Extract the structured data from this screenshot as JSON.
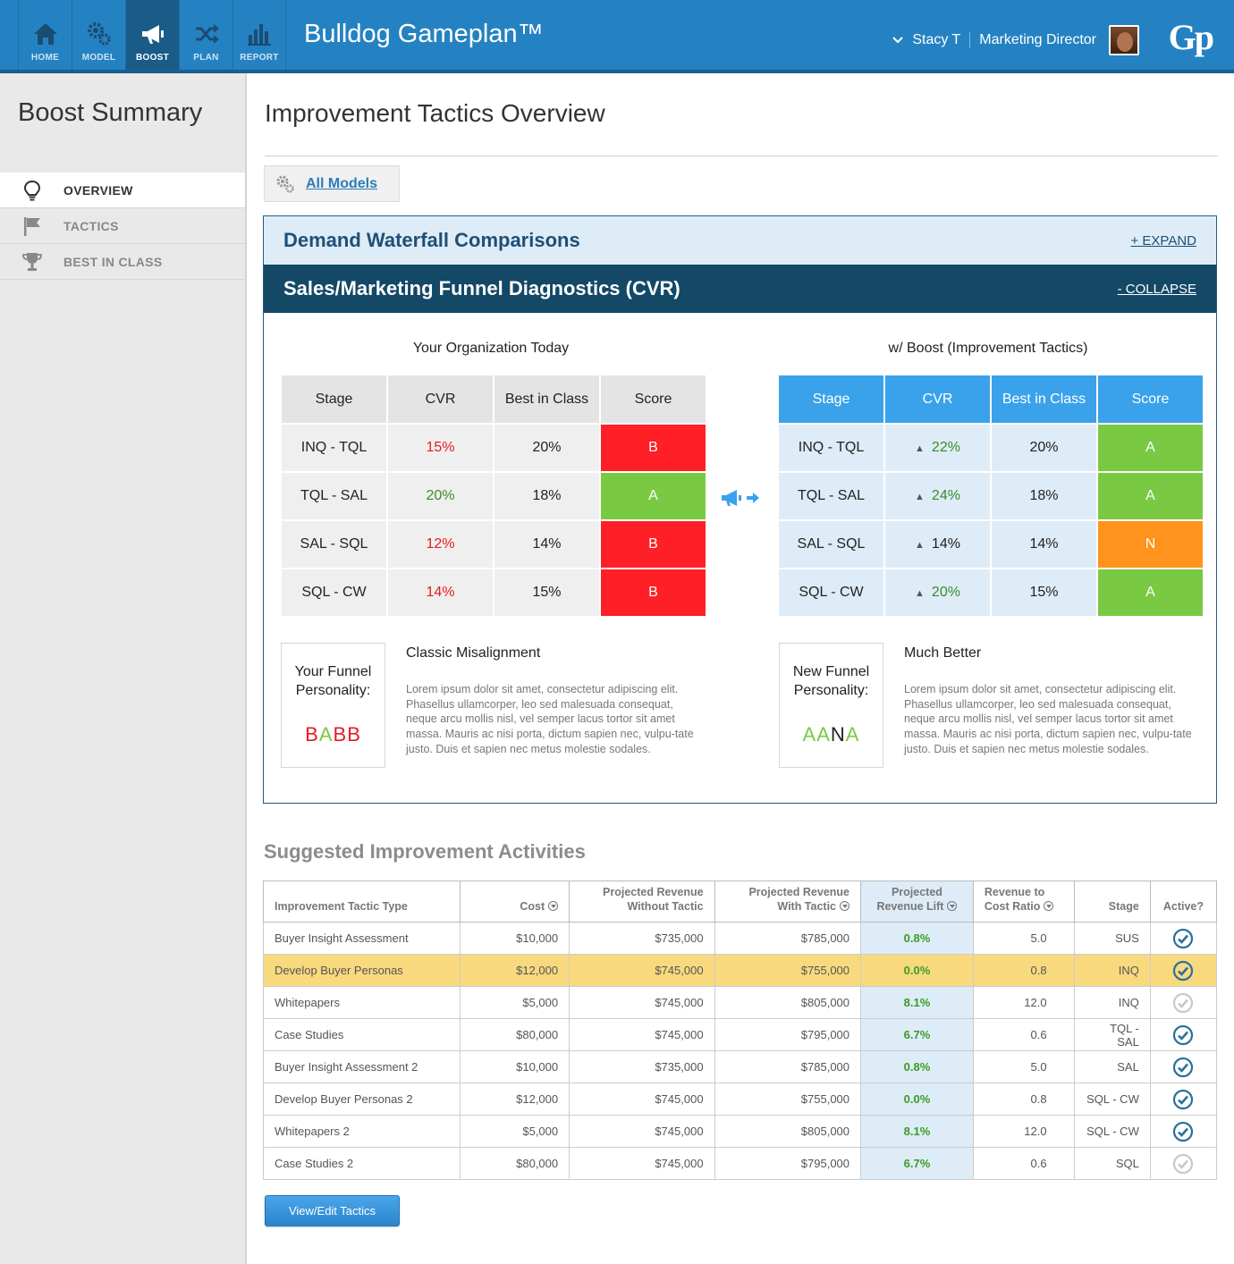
{
  "header": {
    "app_title": "Bulldog Gameplan™",
    "logo": "Gp",
    "user_name": "Stacy T",
    "user_role": "Marketing Director",
    "nav": [
      {
        "label": "HOME",
        "icon": "home-icon"
      },
      {
        "label": "MODEL",
        "icon": "gears-icon"
      },
      {
        "label": "BOOST",
        "icon": "megaphone-icon",
        "active": true
      },
      {
        "label": "PLAN",
        "icon": "shuffle-icon"
      },
      {
        "label": "REPORT",
        "icon": "bar-chart-icon"
      }
    ]
  },
  "sidebar": {
    "title": "Boost Summary",
    "items": [
      {
        "label": "OVERVIEW",
        "icon": "lightbulb-icon",
        "active": true
      },
      {
        "label": "TACTICS",
        "icon": "flag-icon"
      },
      {
        "label": "BEST IN CLASS",
        "icon": "trophy-icon"
      }
    ]
  },
  "main": {
    "title": "Improvement Tactics Overview",
    "all_models": "All Models",
    "panel": {
      "waterfall_title": "Demand Waterfall Comparisons",
      "expand": "+ EXPAND",
      "funnel_title": "Sales/Marketing Funnel Diagnostics (CVR)",
      "collapse": "- COLLAPSE",
      "left_title": "Your Organization Today",
      "right_title": "w/ Boost (Improvement Tactics)",
      "columns": [
        "Stage",
        "CVR",
        "Best in Class",
        "Score"
      ],
      "today_rows": [
        {
          "stage": "INQ - TQL",
          "cvr": "15%",
          "best": "20%",
          "score": "B"
        },
        {
          "stage": "TQL - SAL",
          "cvr": "20%",
          "best": "18%",
          "score": "A"
        },
        {
          "stage": "SAL - SQL",
          "cvr": "12%",
          "best": "14%",
          "score": "B"
        },
        {
          "stage": "SQL - CW",
          "cvr": "14%",
          "best": "15%",
          "score": "B"
        }
      ],
      "boost_rows": [
        {
          "stage": "INQ - TQL",
          "cvr": "22%",
          "best": "20%",
          "score": "A"
        },
        {
          "stage": "TQL - SAL",
          "cvr": "24%",
          "best": "18%",
          "score": "A"
        },
        {
          "stage": "SAL - SQL",
          "cvr": "14%",
          "best": "14%",
          "score": "N"
        },
        {
          "stage": "SQL - CW",
          "cvr": "20%",
          "best": "15%",
          "score": "A"
        }
      ],
      "colors": {
        "red": "#ff1f26",
        "green": "#7ac943",
        "orange": "#ff931e"
      },
      "left_persona": {
        "label_line1": "Your Funnel",
        "label_line2": "Personality:",
        "code": [
          "B",
          "A",
          "B",
          "B"
        ],
        "heading": "Classic Misalignment",
        "text": "Lorem ipsum dolor sit amet, consectetur adipiscing elit. Phasellus ullamcorper, leo sed malesuada consequat, neque arcu mollis nisl, vel semper lacus tortor sit amet massa. Mauris ac nisi porta, dictum sapien nec, vulpu-tate justo. Duis et sapien nec metus molestie sodales."
      },
      "right_persona": {
        "label_line1": "New Funnel",
        "label_line2": "Personality:",
        "code": [
          "A",
          "A",
          "N",
          "A"
        ],
        "heading": "Much Better",
        "text": "Lorem ipsum dolor sit amet, consectetur adipiscing elit. Phasellus ullamcorper, leo sed malesuada consequat, neque arcu mollis nisl, vel semper lacus tortor sit amet massa. Mauris ac nisi porta, dictum sapien nec, vulpu-tate justo. Duis et sapien nec metus molestie sodales."
      }
    },
    "suggested": {
      "title": "Suggested Improvement Activities",
      "headers": {
        "type": "Improvement Tactic Type",
        "cost": "Cost",
        "without_1": "Projected Revenue",
        "without_2": "Without Tactic",
        "with_1": "Projected Revenue",
        "with_2": "With Tactic",
        "lift_1": "Projected",
        "lift_2": "Revenue Lift",
        "ratio_1": "Revenue to",
        "ratio_2": "Cost Ratio",
        "stage": "Stage",
        "active": "Active?"
      },
      "rows": [
        {
          "type": "Buyer Insight Assessment",
          "cost": "$10,000",
          "without": "$735,000",
          "with": "$785,000",
          "lift": "0.8%",
          "ratio": "5.0",
          "stage": "SUS",
          "active": true
        },
        {
          "type": "Develop Buyer Personas",
          "cost": "$12,000",
          "without": "$745,000",
          "with": "$755,000",
          "lift": "0.0%",
          "ratio": "0.8",
          "stage": "INQ",
          "active": true,
          "highlight": true
        },
        {
          "type": "Whitepapers",
          "cost": "$5,000",
          "without": "$745,000",
          "with": "$805,000",
          "lift": "8.1%",
          "ratio": "12.0",
          "stage": "INQ",
          "active": false
        },
        {
          "type": "Case Studies",
          "cost": "$80,000",
          "without": "$745,000",
          "with": "$795,000",
          "lift": "6.7%",
          "ratio": "0.6",
          "stage": "TQL - SAL",
          "active": true
        },
        {
          "type": "Buyer Insight Assessment 2",
          "cost": "$10,000",
          "without": "$735,000",
          "with": "$785,000",
          "lift": "0.8%",
          "ratio": "5.0",
          "stage": "SAL",
          "active": true
        },
        {
          "type": "Develop Buyer Personas 2",
          "cost": "$12,000",
          "without": "$745,000",
          "with": "$755,000",
          "lift": "0.0%",
          "ratio": "0.8",
          "stage": "SQL - CW",
          "active": true
        },
        {
          "type": "Whitepapers 2",
          "cost": "$5,000",
          "without": "$745,000",
          "with": "$805,000",
          "lift": "8.1%",
          "ratio": "12.0",
          "stage": "SQL - CW",
          "active": true
        },
        {
          "type": "Case Studies 2",
          "cost": "$80,000",
          "without": "$745,000",
          "with": "$795,000",
          "lift": "6.7%",
          "ratio": "0.6",
          "stage": "SQL",
          "active": false
        }
      ],
      "button": "View/Edit Tactics"
    }
  }
}
